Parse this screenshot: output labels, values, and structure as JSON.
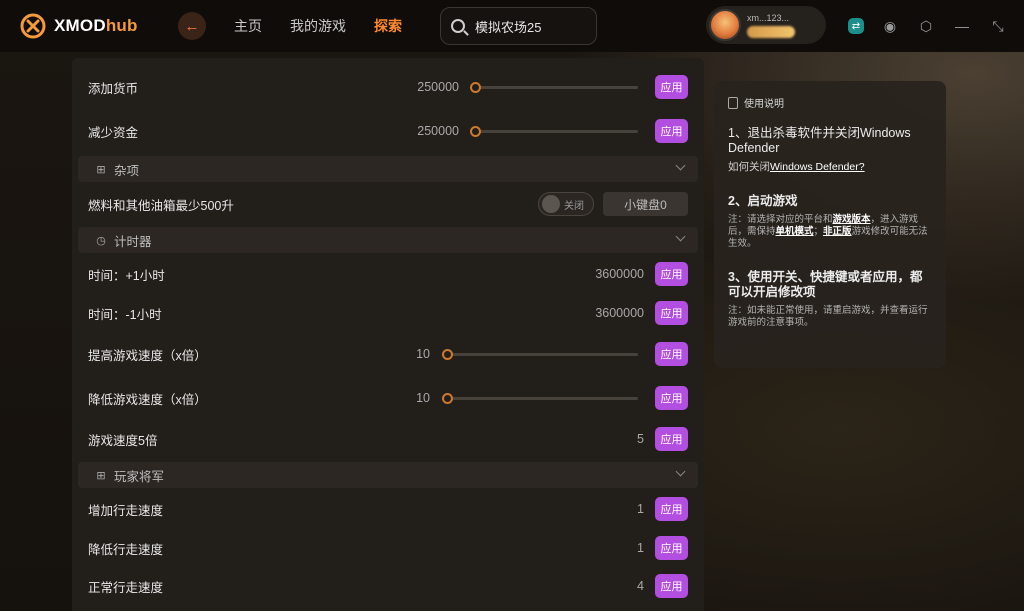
{
  "app": {
    "logo_main": "XMOD",
    "logo_sub": "hub"
  },
  "nav": {
    "items": [
      "主页",
      "我的游戏",
      "探索"
    ],
    "active_index": 2
  },
  "search": {
    "value": "模拟农场25"
  },
  "user": {
    "name": "xm...123..."
  },
  "colors": {
    "accent": "#ff8a2e",
    "apply_button": "#b24fe0",
    "panel": "#221e1a"
  },
  "mods": {
    "rows": [
      {
        "label": "添加货币",
        "value": "250000",
        "control": "slider",
        "slider_level": 0,
        "apply": "应用"
      },
      {
        "label": "减少资金",
        "value": "250000",
        "control": "slider",
        "slider_level": 0,
        "apply": "应用"
      }
    ],
    "section_misc": {
      "label": "杂项"
    },
    "fuel_row": {
      "label": "燃料和其他油箱最少500升",
      "toggle_label": "关闭",
      "hotkey_label": "小键盘0"
    },
    "section_timer": {
      "label": "计时器"
    },
    "timer_rows": [
      {
        "label": "时间：+1小时",
        "value": "3600000",
        "apply": "应用"
      },
      {
        "label": "时间：-1小时",
        "value": "3600000",
        "apply": "应用"
      },
      {
        "label": "提高游戏速度（x倍）",
        "value": "10",
        "control": "slider",
        "slider_level": 0,
        "apply": "应用"
      },
      {
        "label": "降低游戏速度（x倍）",
        "value": "10",
        "control": "slider",
        "slider_level": 0,
        "apply": "应用"
      },
      {
        "label": "游戏速度5倍",
        "value": "5",
        "apply": "应用"
      }
    ],
    "section_player": {
      "label": "玩家将军"
    },
    "player_rows": [
      {
        "label": "增加行走速度",
        "value": "1",
        "apply": "应用"
      },
      {
        "label": "降低行走速度",
        "value": "1",
        "apply": "应用"
      },
      {
        "label": "正常行走速度",
        "value": "4",
        "apply": "应用"
      }
    ]
  },
  "help": {
    "title": "使用说明",
    "step1_title": "1、退出杀毒软件并关闭Windows Defender",
    "step1_prefix": "如何关闭",
    "step1_link": "Windows Defender?",
    "step2_title": "2、启动游戏",
    "step2_note_a": "注：请选择对应的平台和",
    "step2_note_link1": "游戏版本",
    "step2_note_b": "，进入游戏后，需保持",
    "step2_note_link2": "单机模式",
    "step2_note_c": "；",
    "step2_note_link3": "非正版",
    "step2_note_d": "游戏修改可能无法生效。",
    "step3_title": "3、使用开关、快捷键或者应用，都可以开启修改项",
    "step3_note": "注：如未能正常使用，请重启游戏，并查看运行游戏前的注意事项。"
  }
}
